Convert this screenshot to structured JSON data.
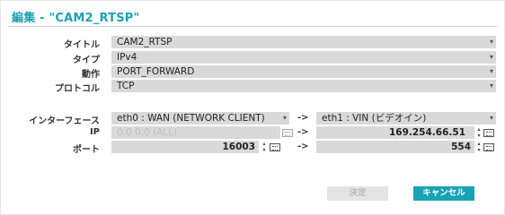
{
  "dialog": {
    "title": "編集 - \"CAM2_RTSP\""
  },
  "form": {
    "title_label": "タイトル",
    "title_value": "CAM2_RTSP",
    "type_label": "タイプ",
    "type_value": "IPv4",
    "action_label": "動作",
    "action_value": "PORT_FORWARD",
    "protocol_label": "プロトコル",
    "protocol_value": "TCP",
    "interface_label": "インターフェース",
    "interface_src": "eth0 : WAN (NETWORK CLIENT)",
    "interface_dst": "eth1 : VIN (ビデオイン)",
    "ip_label": "IP",
    "ip_src": "0.0.0.0 (ALL)",
    "ip_dst": "169.254.66.51",
    "port_label": "ポート",
    "port_src": "16003",
    "port_dst": "554",
    "arrow": "->"
  },
  "buttons": {
    "ok_label": "決定",
    "cancel_label": "キャンセル"
  },
  "colors": {
    "accent": "#1aa3b5",
    "field_bg": "#d9d9d9"
  }
}
